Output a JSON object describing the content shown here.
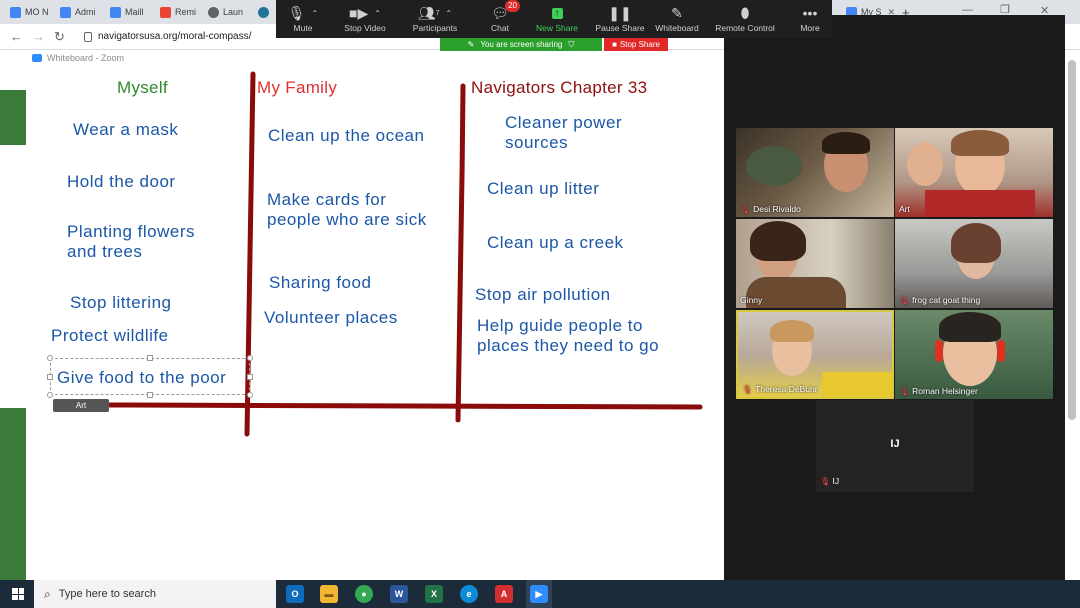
{
  "browser": {
    "tabs": [
      {
        "label": "MO N",
        "color": "#4285f4"
      },
      {
        "label": "Admi",
        "color": "#4285f4"
      },
      {
        "label": "Maill",
        "color": "#4285f4"
      },
      {
        "label": "Remi",
        "color": "#ea4335"
      },
      {
        "label": "Laun",
        "color": "#5f6368"
      },
      {
        "label": "My S",
        "color": "#4285f4"
      }
    ],
    "url": "navigatorsusa.org/moral-compass/"
  },
  "zoom_toolbar": {
    "items": [
      {
        "label": "Mute",
        "icon": "microphone-icon"
      },
      {
        "label": "Stop Video",
        "icon": "video-camera-icon"
      },
      {
        "label": "Participants",
        "icon": "participants-icon",
        "count": "7"
      },
      {
        "label": "Chat",
        "icon": "chat-icon",
        "badge": "20"
      },
      {
        "label": "New Share",
        "icon": "share-arrow-icon"
      },
      {
        "label": "Pause Share",
        "icon": "pause-icon"
      },
      {
        "label": "Whiteboard",
        "icon": "pencil-icon"
      },
      {
        "label": "Remote Control",
        "icon": "mouse-icon"
      },
      {
        "label": "More",
        "icon": "ellipsis-icon"
      }
    ],
    "sharing_banner": "You are screen sharing",
    "stop_share": "Stop Share"
  },
  "whiteboard": {
    "window_title": "Whiteboard - Zoom",
    "columns": [
      {
        "heading": "Myself",
        "heading_color": "#2e8b2e",
        "items": [
          "Wear a mask",
          "Hold the door",
          "Planting flowers\nand trees",
          "Stop littering",
          "Protect wildlife",
          "Give food to the poor"
        ]
      },
      {
        "heading": "My Family",
        "heading_color": "#e03030",
        "items": [
          "Clean up the ocean",
          "Make cards for\npeople who are sick",
          "Sharing food",
          "Volunteer places"
        ]
      },
      {
        "heading": "Navigators Chapter 33",
        "heading_color": "#8b1010",
        "items": [
          "Cleaner power\nsources",
          "Clean up litter",
          "Clean up a creek",
          "Stop air pollution",
          "Help guide people to\nplaces they need to go"
        ]
      }
    ],
    "annotator_label": "Art",
    "line_color": "#8b0a0a",
    "text_color": "#1b57a6"
  },
  "gallery": {
    "participants": [
      {
        "name": "Desi Rivaldo",
        "muted": true
      },
      {
        "name": "Art",
        "muted": false
      },
      {
        "name": "Ginny",
        "muted": false
      },
      {
        "name": "frog cat goat thing",
        "muted": true
      },
      {
        "name": "Theresa DeBuhr",
        "muted": true
      },
      {
        "name": "Roman Helsinger",
        "muted": true
      }
    ],
    "video_off": {
      "initials": "IJ",
      "name": "IJ",
      "muted": true
    }
  },
  "taskbar": {
    "search_placeholder": "Type here to search",
    "apps": [
      {
        "name": "outlook",
        "glyph": "O",
        "color": "#0f6cbd"
      },
      {
        "name": "file-explorer",
        "glyph": "▬",
        "color": "#f2b632"
      },
      {
        "name": "chrome",
        "glyph": "●",
        "color": "#34a853"
      },
      {
        "name": "word",
        "glyph": "W",
        "color": "#2b579a"
      },
      {
        "name": "excel",
        "glyph": "X",
        "color": "#217346"
      },
      {
        "name": "edge",
        "glyph": "e",
        "color": "#0c8bd6"
      },
      {
        "name": "acrobat",
        "glyph": "A",
        "color": "#d32f2f"
      },
      {
        "name": "zoom",
        "glyph": "▶",
        "color": "#2d8cff"
      }
    ]
  }
}
